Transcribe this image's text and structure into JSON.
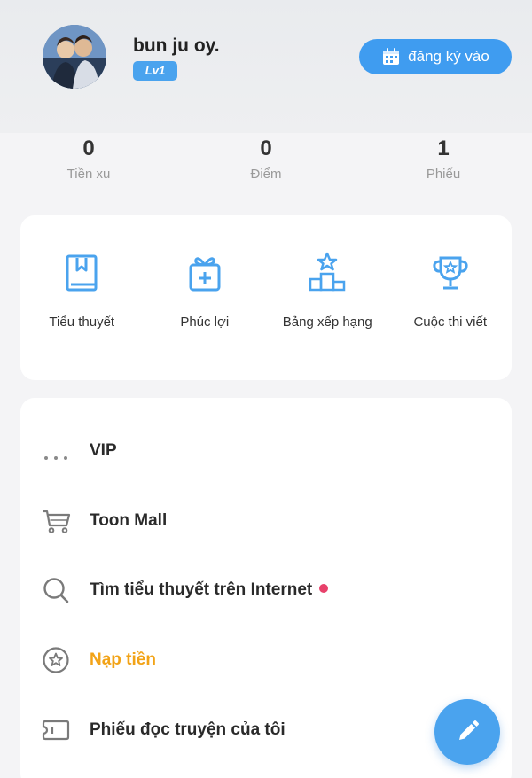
{
  "profile": {
    "username": "bun ju oy.",
    "level": "Lv1",
    "signin_label": "đăng ký vào"
  },
  "stats": [
    {
      "value": "0",
      "label": "Tiền xu"
    },
    {
      "value": "0",
      "label": "Điểm"
    },
    {
      "value": "1",
      "label": "Phiếu"
    }
  ],
  "features": [
    {
      "label": "Tiểu thuyết",
      "icon": "book-icon"
    },
    {
      "label": "Phúc lợi",
      "icon": "gift-icon"
    },
    {
      "label": "Bảng xếp hạng",
      "icon": "ranking-podium-icon"
    },
    {
      "label": "Cuộc thi viết",
      "icon": "trophy-icon"
    }
  ],
  "menu": [
    {
      "label": "VIP",
      "icon": "more-dots-icon"
    },
    {
      "label": "Toon Mall",
      "icon": "cart-icon"
    },
    {
      "label": "Tìm tiểu thuyết trên Internet",
      "icon": "search-icon",
      "badge": "red-dot"
    },
    {
      "label": "Nạp tiền",
      "icon": "coin-star-icon",
      "accent": "#f2a317"
    },
    {
      "label": "Phiếu đọc truyện của tôi",
      "icon": "ticket-icon"
    }
  ],
  "colors": {
    "primary": "#3f9cf0",
    "accent_orange": "#f2a317",
    "badge_red": "#e8416b"
  }
}
